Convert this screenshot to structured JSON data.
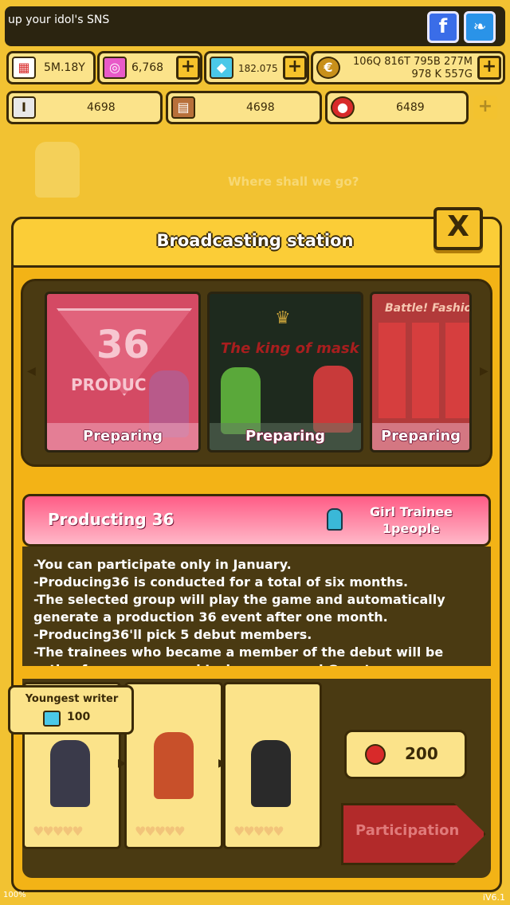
{
  "sns": {
    "text": "up your idol's SNS",
    "facebook_label": "f",
    "twitter_label": "❧"
  },
  "resources": {
    "date": "5M.18Y",
    "pink_gem": "6,768",
    "blue_gem": "182.075",
    "coin_line1": "106Q 816T 795B 277M",
    "coin_line2": "978 K 557G",
    "plus": "+",
    "iron": "4698",
    "brick": "4698",
    "tomato": "6489"
  },
  "ghost": {
    "text": "Where shall we go?"
  },
  "panel": {
    "title": "Broadcasting station",
    "close_label": "X"
  },
  "cards": [
    {
      "name": "Producing 36",
      "big": "36",
      "sub": "PRODUC",
      "status": "Preparing"
    },
    {
      "name": "The king of mask",
      "overlay": "The king of mask",
      "status": "Preparing"
    },
    {
      "name": "Battle! Fashion",
      "overlay": "Battle! Fashio",
      "status": "Preparing"
    }
  ],
  "detail": {
    "title": "Producting 36",
    "trainee_line1": "Girl Trainee",
    "trainee_line2": "1people",
    "lines": [
      "-You can participate only in January.",
      "-Producing36 is conducted for a total of six months.",
      "-The selected group will play the game and automatically generate a production 36 event after one month.",
      "-Producing36'll pick 5 debut members.",
      "-The trainees who became a member of the debut will be active for one year and I win money and Gem to your"
    ]
  },
  "bottom": {
    "tooltip_title": "Youngest writer",
    "tooltip_value": "100",
    "hearts": "♥♥♥♥♥",
    "cost": "200",
    "participate_label": "Participation"
  },
  "footer": {
    "left": "100%",
    "right": "iV6.1"
  },
  "colors": {
    "background": "#f2c232",
    "outline": "#3a2a08",
    "accent_pink": "#ff5c86",
    "button_red": "#b22a2a"
  }
}
